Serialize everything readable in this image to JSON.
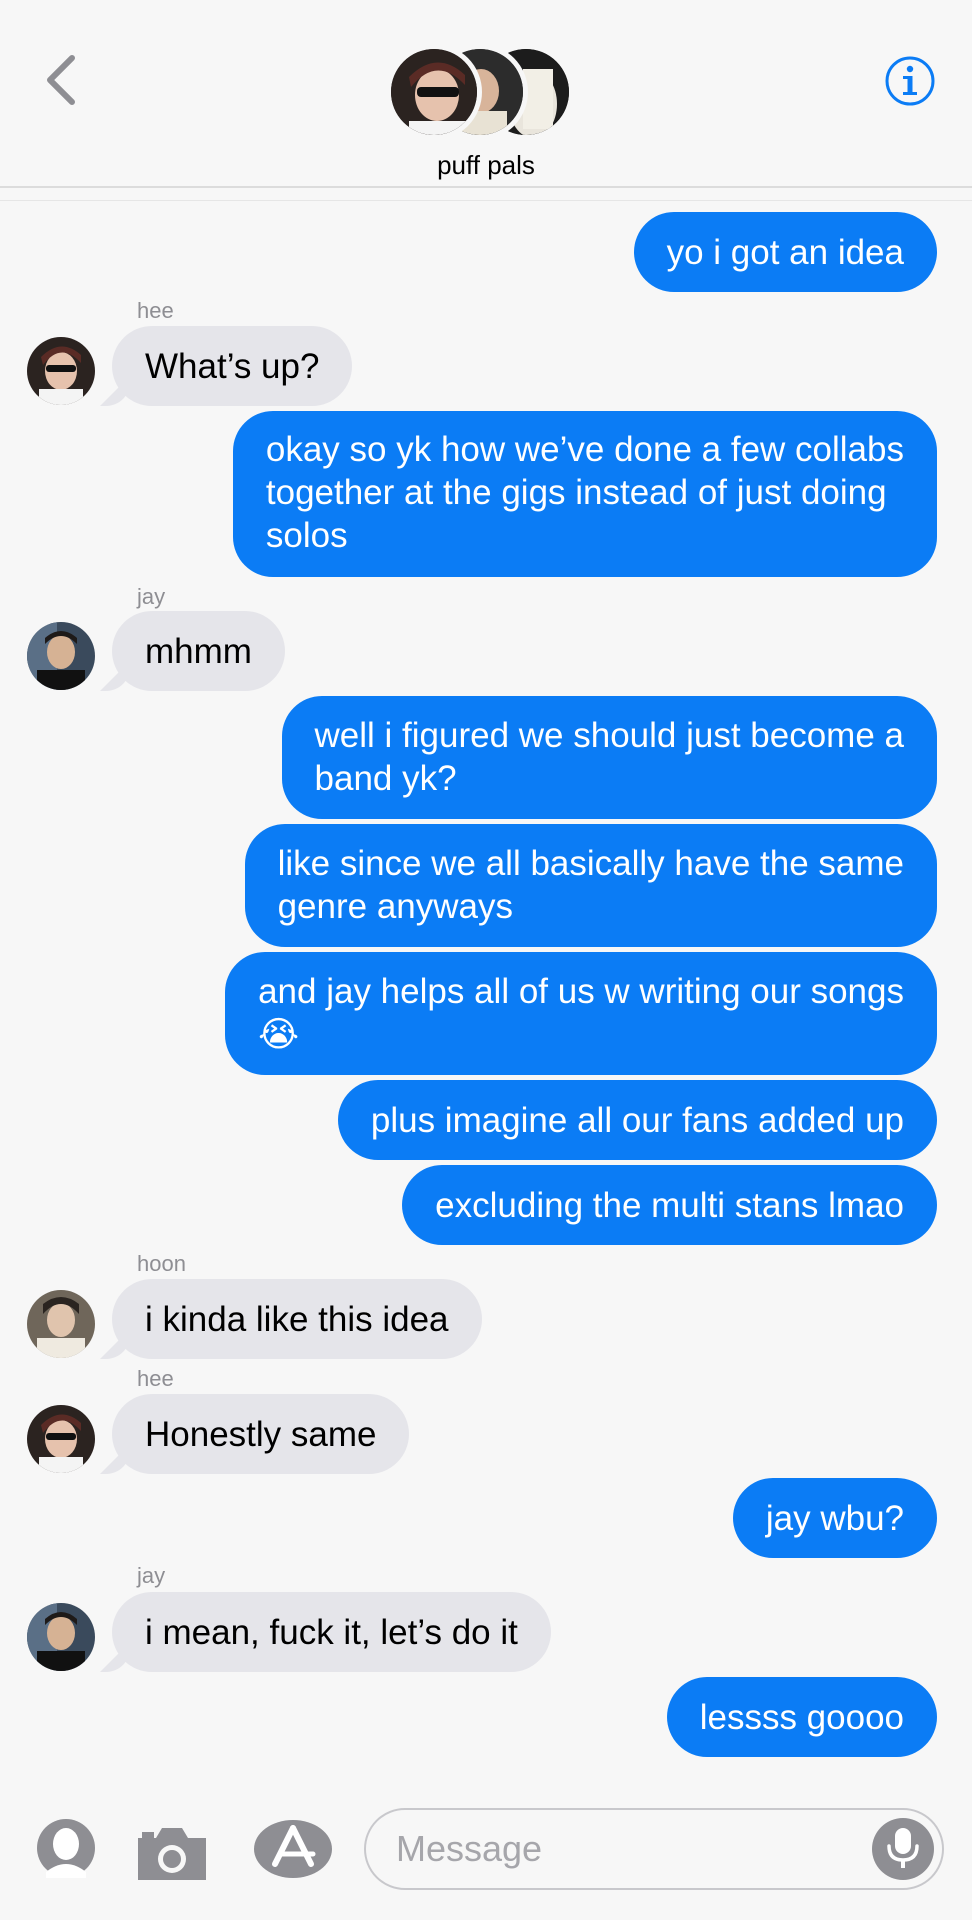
{
  "header": {
    "group_name": "puff pals",
    "back_icon": "chevron-left-icon",
    "info_icon": "info-icon",
    "accent_color": "#0b7cf5"
  },
  "messages": [
    {
      "from": "me",
      "text": "yo i got an idea"
    },
    {
      "from": "hee",
      "sender_label": "hee",
      "text": "What’s up?"
    },
    {
      "from": "me",
      "lines": [
        "okay so yk how we’ve done a few collabs",
        "together at the gigs instead of just doing",
        "solos"
      ]
    },
    {
      "from": "jay",
      "sender_label": "jay",
      "text": "mhmm"
    },
    {
      "from": "me",
      "lines": [
        "well i figured we should just become a",
        "band yk?"
      ]
    },
    {
      "from": "me",
      "lines": [
        "like since we all basically have the same",
        "genre anyways"
      ]
    },
    {
      "from": "me",
      "lines": [
        "and jay helps all of us w writing our songs",
        "😭"
      ]
    },
    {
      "from": "me",
      "text": "plus imagine all our fans added up"
    },
    {
      "from": "me",
      "text": "excluding the multi stans lmao"
    },
    {
      "from": "hoon",
      "sender_label": "hoon",
      "text": "i kinda like this idea"
    },
    {
      "from": "hee",
      "sender_label": "hee",
      "text": "Honestly same"
    },
    {
      "from": "me",
      "text": "jay wbu?"
    },
    {
      "from": "jay",
      "sender_label": "jay",
      "text": "i mean, fuck it, let’s do it"
    },
    {
      "from": "me",
      "text": "lessss goooo"
    }
  ],
  "input_bar": {
    "placeholder": "Message",
    "icons": [
      "memoji-icon",
      "camera-icon",
      "app-store-icon",
      "microphone-icon"
    ]
  },
  "colors": {
    "outgoing_bubble": "#0b7cf5",
    "incoming_bubble": "#e5e5ea",
    "background": "#f7f7f7"
  }
}
